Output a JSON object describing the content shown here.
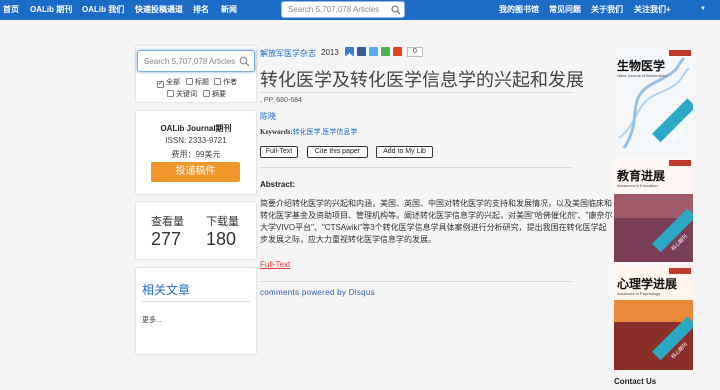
{
  "nav": {
    "home": "首页",
    "oalib_journal": "OALib 期刊",
    "oalib_me": "OALib 我们",
    "fast_submit": "快速投稿通道",
    "ranking": "排名",
    "news": "新闻",
    "my_library": "我的图书馆",
    "faq": "常见问题",
    "about": "关于我们",
    "contact": "关注我们+"
  },
  "search": {
    "top_placeholder": "Search 5,707,078 Articles",
    "left_placeholder": "Search 5,707,078 Articles",
    "options": [
      "全部",
      "标题",
      "作者",
      "关键词",
      "摘要"
    ]
  },
  "journal_box": {
    "title": "OALib Journal期刊",
    "issn": "ISSN: 2333-9721",
    "fee": "费用：99美元",
    "submit_label": "投递稿件"
  },
  "stats": {
    "views_label": "查看量",
    "views": "277",
    "downloads_label": "下载量",
    "downloads": "180"
  },
  "related": {
    "title": "相关文章",
    "more": "更多..."
  },
  "article": {
    "journal": "解放军医学杂志",
    "year": "2013",
    "share_count": "0",
    "title": "转化医学及转化医学信息学的兴起和发展",
    "pages": ", PP. 680-684",
    "author": "陈晓",
    "keywords_label": "Keywords:",
    "keywords": "转化医学,医学信息学",
    "buttons": [
      "Full-Text",
      "Cite this paper",
      "Add to My Lib"
    ],
    "abstract_label": "Abstract:",
    "abstract": "简要介绍转化医学的兴起和内涵，美国、英国、中国对转化医学的支持和发展情况，以及美国临床和转化医学基金及资助项目、管理机构等。阐述转化医学信息学的兴起，对美国\"哈佛催化剂\"、\"康奈尔大学VIVO平台\"、\"CTSAwiki\"等3个转化医学信息学具体案例进行分析研究，提出我国在转化医学起步发展之际，应大力重视转化医学信息学的发展。",
    "fulltext_link": "Full-Text",
    "disqus": "comments powered by Disqus"
  },
  "covers": [
    {
      "title": "生物医学",
      "subtitle": "Hans Journal of Biomedicine",
      "ribbon": "核心期刊",
      "brand": "Hans汉斯"
    },
    {
      "title": "教育进展",
      "subtitle": "Advances in Education",
      "ribbon": "核心期刊",
      "brand": "Hans汉斯"
    },
    {
      "title": "心理学进展",
      "subtitle": "Advances in Psychology",
      "ribbon": "核心期刊",
      "brand": "Hans汉斯"
    }
  ],
  "sidebar": {
    "contact": "Contact Us"
  },
  "colors": {
    "nav": "#1c6bc6",
    "accent": "#f0962a",
    "link": "#1c6bc6"
  }
}
